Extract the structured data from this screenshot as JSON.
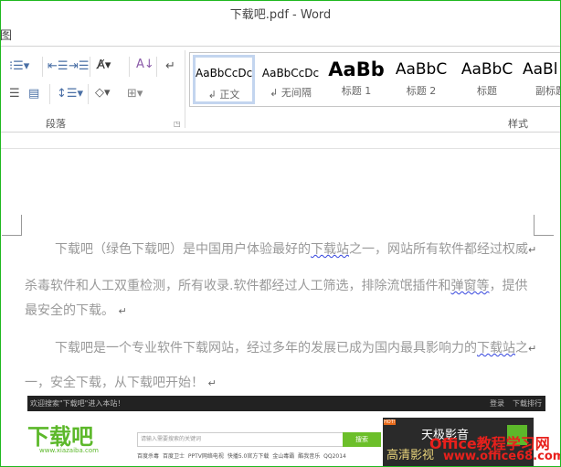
{
  "window": {
    "title": "下载吧.pdf - Word",
    "tab_fragment": "图"
  },
  "ribbon": {
    "groups": {
      "paragraph": "段落",
      "styles": "样式"
    },
    "styles": [
      {
        "sample": "AaBbCcDc",
        "label": "正文",
        "selected": true
      },
      {
        "sample": "AaBbCcDc",
        "label": "无间隔"
      },
      {
        "sample": "AaBb",
        "label": "标题 1"
      },
      {
        "sample": "AaBbC",
        "label": "标题 2"
      },
      {
        "sample": "AaBbC",
        "label": "标题"
      },
      {
        "sample": "AaBl",
        "label": "副标题"
      }
    ]
  },
  "document": {
    "p1": {
      "a": "下载吧（绿色下载吧）是中国用户体验最好的",
      "b": "下载站",
      "c": "之一，网站所有软件都经过权威"
    },
    "p1l2": {
      "a": "杀毒软件和人工双重检测，所有收录.软件都经过人工筛选，排除流氓插件和",
      "b": "弹窗等",
      "c": "，提供"
    },
    "p1l3": "最安全的下载。",
    "p2": {
      "a": "下载吧是一个专业软件下载网站，经过多年的发展已成为国内最具影响力的",
      "b": "下载站",
      "c": "之"
    },
    "p2l2": "一，安全下载，从下载吧开始！",
    "para_mark": "↵"
  },
  "banner": {
    "welcome": "欢迎搜索\"下载吧\"进入本站！",
    "login": "登录",
    "rank": "下载排行",
    "logo": "下载吧",
    "logo_url": "www.xiazaiba.com",
    "search_placeholder": "请输入需要搜索的关键词",
    "search_button": "搜索",
    "links": [
      "百度杀毒",
      "百度卫士",
      "PPTV网络电视",
      "快播5.0官方下载",
      "金山毒霸",
      "酷我音乐",
      "QQ2014"
    ],
    "ad": {
      "hot": "HOT!",
      "name": "天极影音",
      "tagline": "高清影视"
    }
  },
  "watermark": {
    "line1": "Office教程学习网",
    "line2": "www.office68.com"
  }
}
